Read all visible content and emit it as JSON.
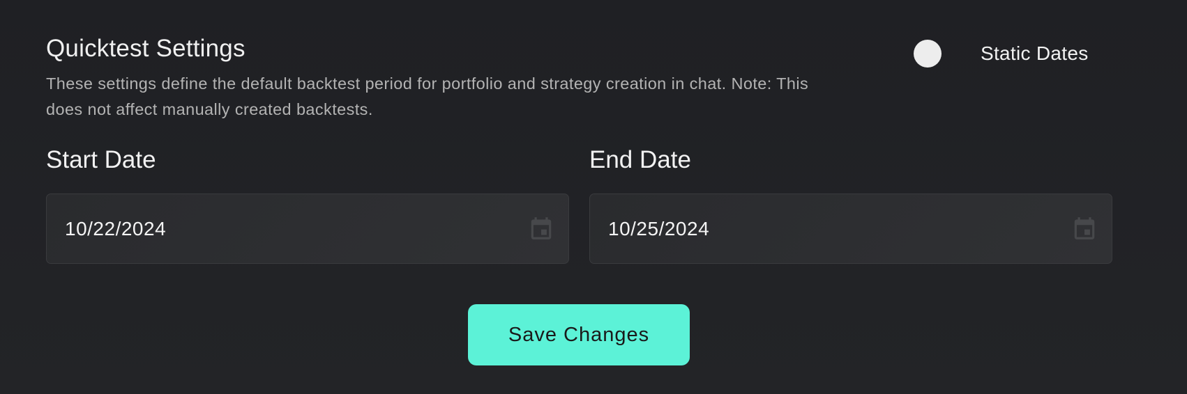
{
  "settings": {
    "title": "Quicktest Settings",
    "description": "These settings define the default backtest period for portfolio and strategy creation in chat. Note: This does not affect manually created backtests.",
    "static_dates_label": "Static Dates"
  },
  "fields": {
    "start": {
      "label": "Start Date",
      "value": "10/22/2024",
      "icon": "calendar-icon"
    },
    "end": {
      "label": "End Date",
      "value": "10/25/2024",
      "icon": "calendar-icon"
    }
  },
  "actions": {
    "save_label": "Save Changes"
  },
  "colors": {
    "background": "#1f2024",
    "accent": "#5cf2d7",
    "field_bg": "#2c2d30",
    "muted_text": "#b3b3b3"
  }
}
